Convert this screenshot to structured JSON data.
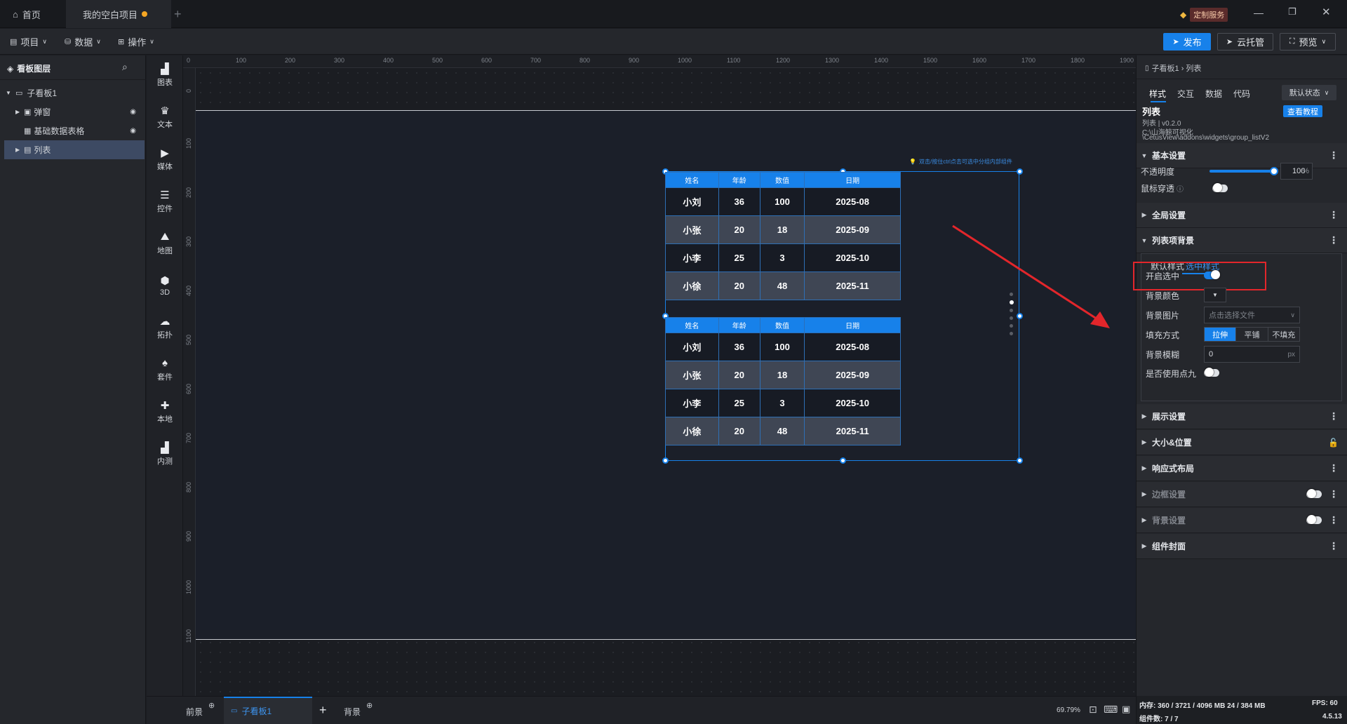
{
  "titlebar": {
    "home_tab": "首页",
    "project_tab": "我的空白项目",
    "custom_service": "定制服务"
  },
  "menubar": {
    "project": "项目",
    "data": "数据",
    "ops": "操作",
    "publish": "发布",
    "cloud": "云托管",
    "preview": "预览"
  },
  "layers": {
    "title": "看板图层",
    "items": [
      {
        "label": "子看板1"
      },
      {
        "label": "弹窗"
      },
      {
        "label": "基础数据表格"
      },
      {
        "label": "列表"
      }
    ]
  },
  "tools": [
    "图表",
    "文本",
    "媒体",
    "控件",
    "地图",
    "3D",
    "拓扑",
    "套件",
    "本地",
    "内测"
  ],
  "ruler": {
    "top": [
      "0",
      "100",
      "200",
      "300",
      "400",
      "500",
      "600",
      "700",
      "800",
      "900",
      "1000",
      "1100",
      "1200",
      "1300",
      "1400",
      "1500",
      "1600",
      "1700",
      "1800",
      "1900"
    ],
    "left": [
      "0",
      "100",
      "200",
      "300",
      "400",
      "500",
      "600",
      "700",
      "800",
      "900",
      "1000",
      "1100"
    ]
  },
  "canvas": {
    "hint": "双击/按住ctrl点击可选中分组内部组件",
    "table": {
      "headers": [
        "姓名",
        "年龄",
        "数值",
        "日期"
      ],
      "rows": [
        [
          "小刘",
          "36",
          "100",
          "2025-08"
        ],
        [
          "小张",
          "20",
          "18",
          "2025-09"
        ],
        [
          "小李",
          "25",
          "3",
          "2025-10"
        ],
        [
          "小徐",
          "20",
          "48",
          "2025-11"
        ]
      ]
    }
  },
  "bottombar": {
    "front": "前景",
    "sub_board": "子看板1",
    "back": "背景",
    "zoom": "69.79%"
  },
  "right": {
    "breadcrumb": "子看板1 › 列表",
    "tabs": [
      "样式",
      "交互",
      "数据",
      "代码"
    ],
    "state": "默认状态",
    "widget_name": "列表",
    "tutorial": "查看教程",
    "version": "列表 | v0.2.0",
    "path1": "C:\\山海鲸可视化",
    "path2": "\\CetusView\\addons\\widgets\\group_listV2",
    "basic": "基本设置",
    "opacity_label": "不透明度",
    "opacity_value": "100",
    "opacity_unit": "%",
    "mouse_label": "鼠标穿透",
    "global": "全局设置",
    "item_bg": "列表项背景",
    "subtab_default": "默认样式",
    "subtab_selected": "选中样式",
    "enable_select": "开启选中",
    "bg_color": "背景颜色",
    "bg_image": "背景图片",
    "bg_image_placeholder": "点击选择文件",
    "fill_mode": "填充方式",
    "fill_options": [
      "拉伸",
      "平铺",
      "不填充"
    ],
    "bg_blur": "背景模糊",
    "bg_blur_value": "0",
    "bg_blur_unit": "px",
    "nine_slice": "是否使用点九",
    "display": "展示设置",
    "size_pos": "大小&位置",
    "responsive": "响应式布局",
    "border": "边框设置",
    "background": "背景设置",
    "cover": "组件封面"
  },
  "status": {
    "memory": "内存: 360 / 3721 / 4096 MB  24 / 384 MB",
    "fps": "FPS: 60",
    "widgets": "组件数: 7 / 7",
    "version": "4.5.13"
  },
  "colors": {
    "accent": "#1781ea",
    "highlight_box": "#e3262b",
    "arrow": "#e3262b"
  }
}
